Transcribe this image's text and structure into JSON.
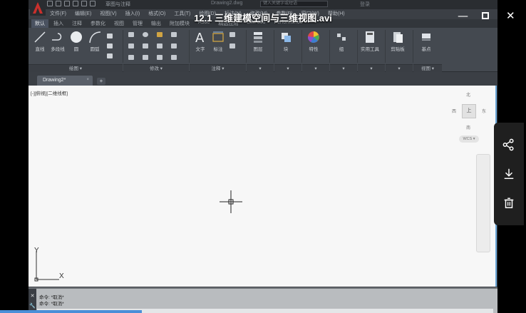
{
  "video": {
    "title": "12.1 三维建模空间与三维视图.avi",
    "controls": {
      "minimize_icon": "minimize-icon",
      "maximize_icon": "maximize-icon",
      "close_icon": "close-icon",
      "minimize_glyph": "—",
      "close_glyph": "✕"
    },
    "side_actions": [
      {
        "name": "share-icon"
      },
      {
        "name": "download-icon"
      },
      {
        "name": "trash-icon"
      }
    ],
    "progress_fraction": 0.27
  },
  "cad": {
    "workspace": "草图与注释",
    "document_name": "Drawing2.dwg",
    "search_placeholder": "键入关键字或短语",
    "user": "登录",
    "menu": [
      "文件(F)",
      "编辑(E)",
      "视图(V)",
      "插入(I)",
      "格式(O)",
      "工具(T)",
      "绘图(D)",
      "标注(N)",
      "修改(M)",
      "参数(P)",
      "窗口(W)",
      "帮助(H)"
    ],
    "ribbon_tabs": [
      "默认",
      "插入",
      "注释",
      "参数化",
      "视图",
      "管理",
      "输出",
      "附加模块",
      "A360",
      "精选应用",
      "BIM 360",
      "Performance"
    ],
    "active_tab_index": 0,
    "ribbon_tools": {
      "line": "直线",
      "polyline": "多段线",
      "circle": "圆",
      "arc": "圆弧",
      "text": "文字",
      "dimension": "标注",
      "layers": "图层",
      "block": "块",
      "properties": "特性",
      "group": "组",
      "utilities": "实用工具",
      "clipboard": "剪贴板",
      "base": "基点"
    },
    "panel_labels": {
      "draw": "绘图 ▾",
      "modify": "修改 ▾",
      "annotation": "注释 ▾",
      "view": "视图 ▾"
    },
    "file_tab": "Drawing2*",
    "file_tab_close": "×",
    "new_tab": "+",
    "viewport_label": "[-][俯视][二维线框]",
    "viewcube": {
      "north": "北",
      "south": "南",
      "east": "东",
      "west": "西",
      "top": "上",
      "wcs": "WCS ▾"
    },
    "ucs": {
      "x": "X",
      "y": "Y"
    },
    "command_lines": [
      "命令: *取消*",
      "命令: *取消*"
    ],
    "command_side_icons": [
      "✕",
      "🔧"
    ]
  }
}
